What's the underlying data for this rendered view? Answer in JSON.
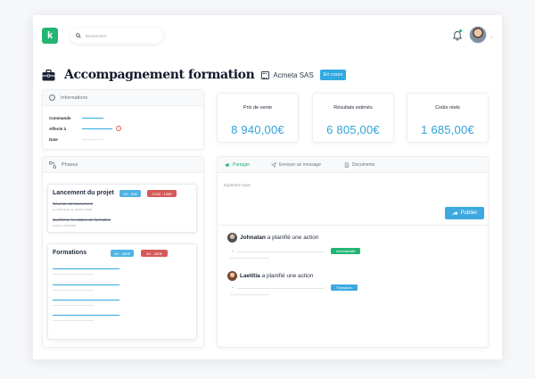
{
  "header": {
    "logo_letter": "k",
    "search_placeholder": "Rechercher",
    "colors": {
      "brand": "#22b573",
      "accent": "#2fa3d9"
    }
  },
  "page": {
    "title": "Accompagnement formation",
    "company": "Acmeta SAS",
    "status": "En cours"
  },
  "informations": {
    "heading": "Informations",
    "rows": [
      {
        "label": "Commande"
      },
      {
        "label": "Affecté à"
      },
      {
        "label": "Date"
      }
    ]
  },
  "kpis": [
    {
      "label": "Prix de vente",
      "value": "8 940,00€"
    },
    {
      "label": "Résultats estimés",
      "value": "6 805,00€"
    },
    {
      "label": "Coûts réels",
      "value": "1 685,00€"
    }
  ],
  "phases": {
    "heading": "Phases",
    "items": [
      {
        "title": "Lancement du projet",
        "badges": [
          "1H - 90€",
          "1H30 - 135€"
        ],
        "tasks": [
          {
            "label": "Réunion de lancement",
            "sub": "Le 14/07/2021 de 14h00 à 15h00"
          },
          {
            "label": "Confirmer les dates de formation",
            "sub": "Avant le 20/07/2021"
          }
        ]
      },
      {
        "title": "Formations",
        "badges": [
          "5H - 450€",
          "4H - 360€"
        ]
      }
    ]
  },
  "activity": {
    "tabs": [
      {
        "label": "Partager",
        "icon": "megaphone-icon"
      },
      {
        "label": "Envoyer un message",
        "icon": "send-icon"
      },
      {
        "label": "Documents",
        "icon": "document-icon"
      }
    ],
    "placeholder": "Exprimez-vous",
    "publish_label": "Publier",
    "feed": [
      {
        "name": "Johnatan",
        "action": "a planifié une action",
        "tag": "Administratif"
      },
      {
        "name": "Laetitia",
        "action": "a planifié une action",
        "tag": "Formation"
      }
    ]
  }
}
